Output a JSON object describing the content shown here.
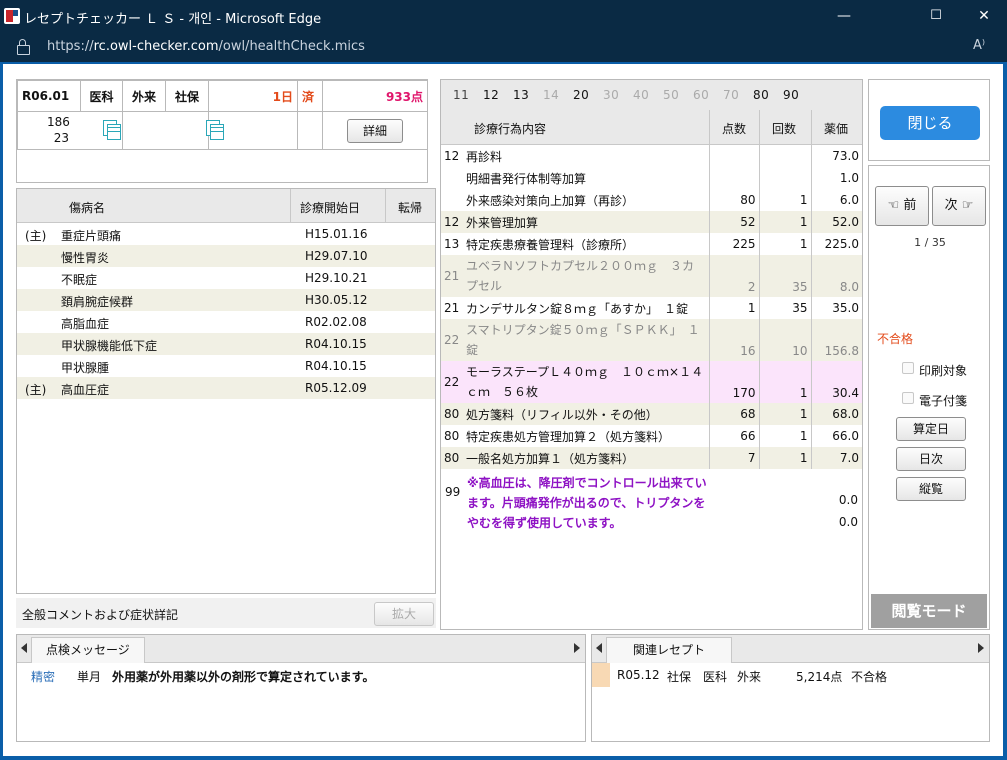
{
  "window": {
    "title": "レセプトチェッカー Ｌ Ｓ - 개인 - Microsoft Edge",
    "minimize": "—",
    "maximize": "☐",
    "close": "✕"
  },
  "address": {
    "scheme": "https://",
    "host": "rc.owl-checker.com",
    "path": "/owl/healthCheck.mics",
    "reader_icon": "A⁾"
  },
  "receipt": {
    "date": "R06.01",
    "dept": "医科",
    "type": "外来",
    "insurance": "社保",
    "days": "1日",
    "done": "済",
    "points": "933点",
    "patient_line1": "186",
    "patient_line2": "23",
    "detail_button": "詳細"
  },
  "disease_list": {
    "col_name": "傷病名",
    "col_start": "診療開始日",
    "col_outcome": "転帰",
    "rows": [
      {
        "flag": "(主)",
        "name": "重症片頭痛",
        "start": "H15.01.16"
      },
      {
        "flag": "",
        "name": "慢性胃炎",
        "start": "H29.07.10"
      },
      {
        "flag": "",
        "name": "不眠症",
        "start": "H29.10.21"
      },
      {
        "flag": "",
        "name": "頚肩腕症候群",
        "start": "H30.05.12"
      },
      {
        "flag": "",
        "name": "高脂血症",
        "start": "R02.02.08"
      },
      {
        "flag": "",
        "name": "甲状腺機能低下症",
        "start": "R04.10.15"
      },
      {
        "flag": "",
        "name": "甲状腺腫",
        "start": "R04.10.15"
      },
      {
        "flag": "(主)",
        "name": "高血圧症",
        "start": "R05.12.09"
      }
    ],
    "comment_label": "全般コメントおよび症状詳記",
    "expand_button": "拡大"
  },
  "category_numbers": [
    {
      "label": "11",
      "state": "off"
    },
    {
      "label": "12",
      "state": "on"
    },
    {
      "label": "13",
      "state": "on"
    },
    {
      "label": "14",
      "state": "off"
    },
    {
      "label": "20",
      "state": "on"
    },
    {
      "label": "30",
      "state": "off"
    },
    {
      "label": "40",
      "state": "off"
    },
    {
      "label": "50",
      "state": "off"
    },
    {
      "label": "60",
      "state": "off"
    },
    {
      "label": "70",
      "state": "off"
    },
    {
      "label": "80",
      "state": "on"
    },
    {
      "label": "90",
      "state": "on"
    }
  ],
  "treatment": {
    "col_content": "診療行為内容",
    "col_points": "点数",
    "col_count": "回数",
    "col_drug": "薬価",
    "rows": [
      {
        "code": "12",
        "content": "再診料",
        "points": "",
        "count": "",
        "price": "73.0",
        "style": ""
      },
      {
        "code": "",
        "content": "明細書発行体制等加算",
        "points": "",
        "count": "",
        "price": "1.0",
        "style": ""
      },
      {
        "code": "",
        "content": "外来感染対策向上加算（再診）",
        "points": "80",
        "count": "1",
        "price": "6.0",
        "style": ""
      },
      {
        "code": "12",
        "content": "外来管理加算",
        "points": "52",
        "count": "1",
        "price": "52.0",
        "style": "alt"
      },
      {
        "code": "13",
        "content": "特定疾患療養管理料（診療所）",
        "points": "225",
        "count": "1",
        "price": "225.0",
        "style": ""
      },
      {
        "code": "21",
        "content": "ユベラＮソフトカプセル２００ｍｇ　３カプセル",
        "points": "2",
        "count": "35",
        "price": "8.0",
        "style": "alt gray"
      },
      {
        "code": "21",
        "content": "カンデサルタン錠８ｍｇ「あすか」　１錠",
        "points": "1",
        "count": "35",
        "price": "35.0",
        "style": ""
      },
      {
        "code": "22",
        "content": "スマトリプタン錠５０ｍｇ「ＳＰＫＫ」　１錠",
        "points": "16",
        "count": "10",
        "price": "156.8",
        "style": "alt gray"
      },
      {
        "code": "22",
        "content": "モーラステープＬ４０ｍｇ　１０ｃｍ×１４ｃｍ　５６枚",
        "points": "170",
        "count": "1",
        "price": "30.4",
        "style": "pink"
      },
      {
        "code": "80",
        "content": "処方箋料（リフィル以外・その他）",
        "points": "68",
        "count": "1",
        "price": "68.0",
        "style": "alt"
      },
      {
        "code": "80",
        "content": "特定疾患処方管理加算２（処方箋料）",
        "points": "66",
        "count": "1",
        "price": "66.0",
        "style": ""
      },
      {
        "code": "80",
        "content": "一般名処方加算１（処方箋料）",
        "points": "7",
        "count": "1",
        "price": "7.0",
        "style": "alt"
      }
    ],
    "comment_code": "99",
    "comment_text_1": "※高血圧は、降圧剤でコントロール出来ています。片頭痛発作が出るので、トリプタ",
    "comment_text_2": "ンをやむを得ず使用しています。",
    "comment_price_1": "0.0",
    "comment_price_2": "0.0"
  },
  "right_panel": {
    "close_button": "閉じる",
    "prev_button": "前",
    "next_button": "次",
    "pager": "1 / 35",
    "result": "不合格",
    "print_target": "印刷対象",
    "e_sticky": "電子付箋",
    "calc_date_button": "算定日",
    "daily_button": "日次",
    "vertical_button": "縦覧",
    "browse_mode": "閲覧モード"
  },
  "messages": {
    "tab_label": "点検メッセージ",
    "row_level": "精密",
    "row_scope": "単月",
    "row_text": "外用薬が外用薬以外の剤形で算定されています。"
  },
  "related": {
    "tab_label": "関連レセプト",
    "row_date": "R05.12",
    "row_insurance": "社保",
    "row_dept": "医科",
    "row_type": "外来",
    "row_points": "5,214点",
    "row_result": "不合格"
  },
  "colors": {
    "accent_blue": "#2c8be0",
    "red": "#e34b1b",
    "pink_text": "#e0166b",
    "purple": "#8e12c4",
    "highlight_pink": "#fbe4fb"
  }
}
